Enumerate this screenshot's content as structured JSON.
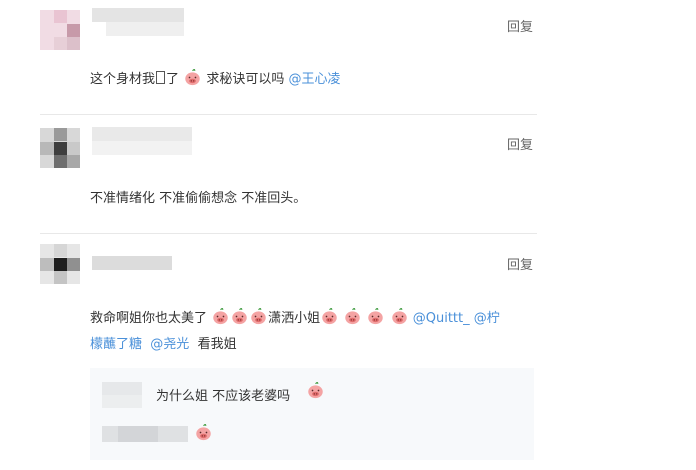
{
  "comments": [
    {
      "reply_label": "回复",
      "text_parts": [
        "这个身材我",
        "了",
        "求秘诀可以吗"
      ],
      "mention": "@王心凌"
    },
    {
      "reply_label": "回复",
      "text": "不准情绪化 不准偷偷想念 不准回头。"
    },
    {
      "reply_label": "回复",
      "line1_part1": "救命啊姐你也太美了",
      "line1_part2": "潇洒小姐",
      "mention1": "@Quittt_",
      "mention2_a": "@柠",
      "mention2_b": "檬蘸了糖",
      "mention3": "@尧光",
      "line2_tail": "看我姐",
      "sub_replies": [
        {
          "text": "为什么姐 不应该老婆吗"
        },
        {
          "text": ""
        }
      ]
    }
  ],
  "colors": {
    "mention": "#4a90d9",
    "reply": "#666666",
    "divider": "#e8e8e8",
    "sub_bg": "#f7f9fb"
  },
  "icons": [
    "pig-emoji-icon",
    "box-glyph-icon"
  ]
}
